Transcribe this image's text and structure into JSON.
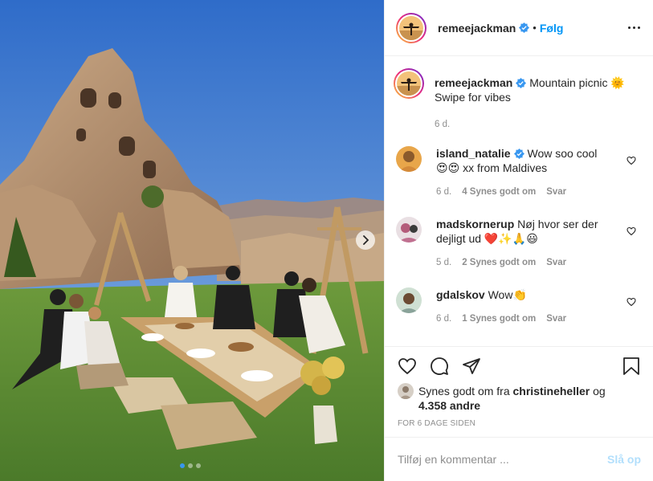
{
  "header": {
    "username": "remeejackman",
    "separator": "•",
    "follow_label": "Følg"
  },
  "caption": {
    "username": "remeejackman",
    "text": "Mountain picnic 🌞",
    "line2": "Swipe for vibes",
    "time": "6 d."
  },
  "comments": [
    {
      "username": "island_natalie",
      "verified": true,
      "text": "Wow soo cool",
      "text2": "😍😍 xx from Maldives",
      "time": "6 d.",
      "likes": "4 Synes godt om",
      "reply": "Svar"
    },
    {
      "username": "madskornerup",
      "verified": false,
      "text": "Nøj hvor ser der",
      "text2": "dejligt ud ❤️✨🙏😃",
      "time": "5 d.",
      "likes": "2 Synes godt om",
      "reply": "Svar"
    },
    {
      "username": "gdalskov",
      "verified": false,
      "text": "Wow👏",
      "text2": "",
      "time": "6 d.",
      "likes": "1 Synes godt om",
      "reply": "Svar"
    }
  ],
  "likes": {
    "prefix": "Synes godt om fra",
    "user": "christineheller",
    "connector": "og",
    "others": "4.358 andre"
  },
  "timestamp": "FOR 6 DAGE SIDEN",
  "add_comment": {
    "placeholder": "Tilføj en kommentar ...",
    "post_label": "Slå op"
  },
  "carousel": {
    "current": 1,
    "total": 3
  },
  "icons": {
    "heart": "heart-icon",
    "comment": "comment-icon",
    "share": "paper-plane-icon",
    "save": "bookmark-icon",
    "more": "more-icon",
    "next": "chevron-right-icon",
    "verified": "verified-badge-icon"
  },
  "colors": {
    "accent": "#0095f6",
    "verified": "#3897f0",
    "muted": "#8e8e8e",
    "post_disabled": "#b2dffc"
  }
}
